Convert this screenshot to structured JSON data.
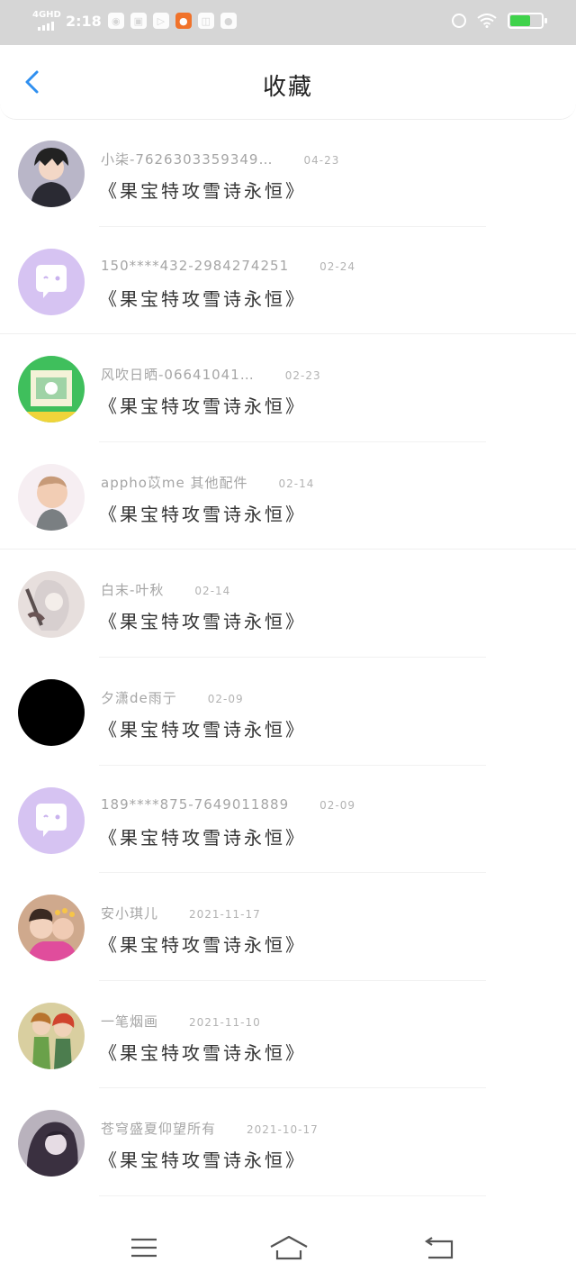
{
  "status_bar": {
    "network": "4GHD",
    "time": "2:18"
  },
  "header": {
    "title": "收藏",
    "back_icon": "chevron-left-icon",
    "accent_color": "#2f8ff0"
  },
  "favorites": [
    {
      "name": "小柒-7626303359349…",
      "date": "04-23",
      "work": "《果宝特攻雪诗永恒》",
      "avatar": "anime-dark"
    },
    {
      "name": "150****432-2984274251",
      "date": "02-24",
      "work": "《果宝特攻雪诗永恒》",
      "avatar": "default-chat"
    },
    {
      "name": "风吹日晒-06641041…",
      "date": "02-23",
      "work": "《果宝特攻雪诗永恒》",
      "avatar": "green-card"
    },
    {
      "name": "appho苡me 其他配件",
      "date": "02-14",
      "work": "《果宝特攻雪诗永恒》",
      "avatar": "baby"
    },
    {
      "name": "白末-叶秋",
      "date": "02-14",
      "work": "《果宝特攻雪诗永恒》",
      "avatar": "anime-sketch"
    },
    {
      "name": "夕潇de雨亍",
      "date": "02-09",
      "work": "《果宝特攻雪诗永恒》",
      "avatar": "black"
    },
    {
      "name": "189****875-7649011889",
      "date": "02-09",
      "work": "《果宝特攻雪诗永恒》",
      "avatar": "default-chat"
    },
    {
      "name": "安小琪儿",
      "date": "2021-11-17",
      "work": "《果宝特攻雪诗永恒》",
      "avatar": "kids-photo"
    },
    {
      "name": "一笔烟画",
      "date": "2021-11-10",
      "work": "《果宝特攻雪诗永恒》",
      "avatar": "cartoon-pair"
    },
    {
      "name": "苍穹盛夏仰望所有",
      "date": "2021-10-17",
      "work": "《果宝特攻雪诗永恒》",
      "avatar": "portrait-dark"
    }
  ],
  "nav_bar": {
    "menu_icon": "menu-icon",
    "home_icon": "home-icon",
    "back_icon": "return-icon"
  }
}
